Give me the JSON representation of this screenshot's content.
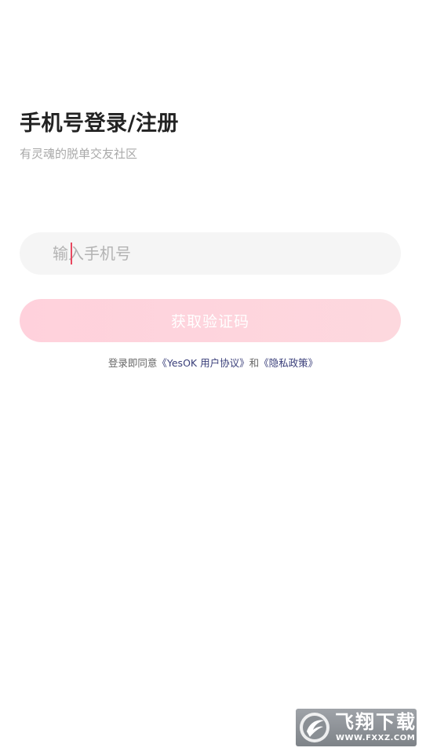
{
  "header": {
    "title": "手机号登录/注册",
    "subtitle": "有灵魂的脱单交友社区"
  },
  "phone": {
    "value": "",
    "placeholder": "输入手机号"
  },
  "actions": {
    "get_code_label": "获取验证码"
  },
  "agreement": {
    "prefix": "登录即同意",
    "user_agreement": "《YesOK 用户协议》",
    "connector": "和",
    "privacy_policy": "《隐私政策》"
  },
  "watermark": {
    "brand": "飞翔下载",
    "url": "WWW.FXXZ.COM"
  },
  "colors": {
    "accent": "#ffd1dc",
    "link": "#3a3f7a",
    "caret": "#e8475f"
  }
}
